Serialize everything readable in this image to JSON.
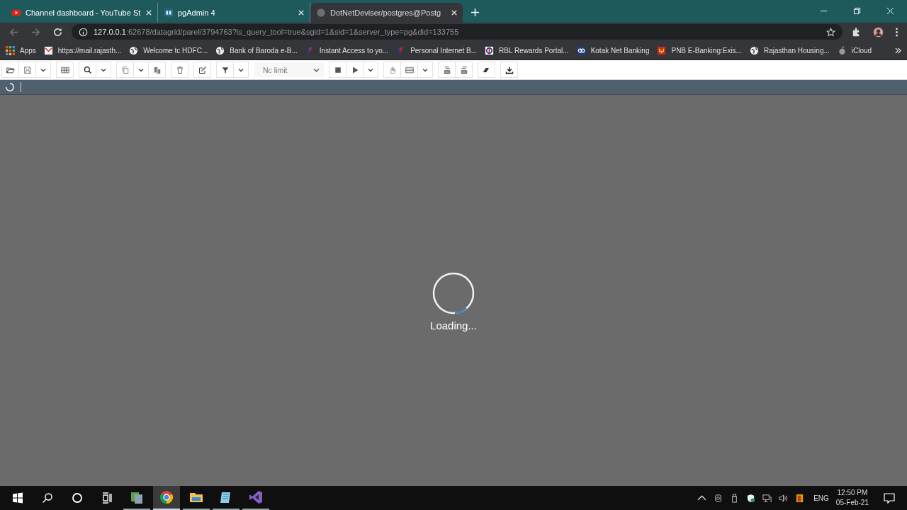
{
  "tabs": [
    {
      "title": "Channel dashboard - YouTube St",
      "kind": "youtube",
      "selected": false
    },
    {
      "title": "pgAdmin 4",
      "kind": "pg",
      "selected": false
    },
    {
      "title": "DotNetDeviser/postgres@Postg",
      "kind": "globe",
      "selected": true
    }
  ],
  "address": {
    "host": "127.0.0.1",
    "rest": ":62678/datagrid/parel/3794763?is_query_tool=true&sgid=1&sid=1&server_type=pg&did=133755"
  },
  "bookmarks": [
    {
      "label": "Apps",
      "kind": "apps"
    },
    {
      "label": "https://mail.rajasth...",
      "kind": "mail"
    },
    {
      "label": "Welcome tc HDFC...",
      "kind": "globe"
    },
    {
      "label": "Bank of Baroda e-B...",
      "kind": "globe"
    },
    {
      "label": "Instant Access to yo...",
      "kind": "flag"
    },
    {
      "label": "Personal Internet B...",
      "kind": "flag"
    },
    {
      "label": "RBL Rewards Portal...",
      "kind": "rbl"
    },
    {
      "label": "Kotak Net Banking",
      "kind": "kotak"
    },
    {
      "label": "PNB E-Banking:Exis...",
      "kind": "pnb"
    },
    {
      "label": "Rajasthan Housing...",
      "kind": "globe"
    },
    {
      "label": "iCloud",
      "kind": "apple"
    }
  ],
  "query_toolbar": {
    "row_limit": "Nc limit"
  },
  "loading": {
    "message": "Loading..."
  },
  "taskbar": {
    "apps": [
      {
        "kind": "files",
        "selected": false
      },
      {
        "kind": "chrome",
        "selected": true
      },
      {
        "kind": "folder",
        "selected": false
      },
      {
        "kind": "notepad",
        "selected": false
      },
      {
        "kind": "vs",
        "selected": false
      }
    ],
    "language": "ENG",
    "time": "12:50 PM",
    "date": "05-Feb-21"
  }
}
